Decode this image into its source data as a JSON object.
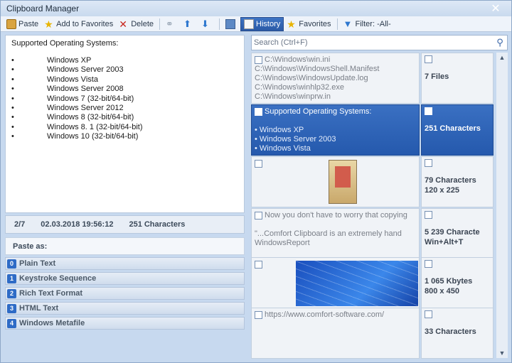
{
  "window": {
    "title": "Clipboard Manager",
    "close_glyph": "✕"
  },
  "toolbar": {
    "paste_label": "Paste",
    "add_favorites_label": "Add to Favorites",
    "delete_label": "Delete",
    "history_label": "History",
    "favorites_label": "Favorites",
    "filter_label": "Filter: -All-"
  },
  "preview": {
    "heading": "Supported Operating Systems:",
    "bullet": "•",
    "items": [
      "Windows XP",
      "Windows Server 2003",
      "Windows Vista",
      "Windows Server 2008",
      "Windows 7 (32-bit/64-bit)",
      "Windows Server 2012",
      "Windows 8 (32-bit/64-bit)",
      "Windows 8. 1 (32-bit/64-bit)",
      "Windows 10 (32-bit/64-bit)"
    ]
  },
  "info": {
    "position": "2/7",
    "date": "02.03.2018 19:56:12",
    "size": "251 Characters"
  },
  "paste_as": {
    "label": "Paste as:",
    "formats": [
      {
        "num": "0",
        "label": "Plain Text"
      },
      {
        "num": "1",
        "label": "Keystroke Sequence"
      },
      {
        "num": "2",
        "label": "Rich Text Format"
      },
      {
        "num": "3",
        "label": "HTML Text"
      },
      {
        "num": "4",
        "label": "Windows Metafile"
      }
    ]
  },
  "search": {
    "placeholder": "Search (Ctrl+F)"
  },
  "history": {
    "items": [
      {
        "lines": [
          "C:\\Windows\\win.ini",
          "C:\\Windows\\WindowsShell.Manifest",
          "C:\\Windows\\WindowsUpdate.log",
          "C:\\Windows\\winhlp32.exe",
          "C:\\Windows\\winprw.in"
        ],
        "meta": [
          "7 Files"
        ]
      },
      {
        "lines": [
          "Supported Operating Systems:",
          "",
          "• Windows XP",
          "• Windows Server 2003",
          "• Windows Vista"
        ],
        "meta": [
          "251 Characters"
        ]
      },
      {
        "lines": [],
        "meta": [
          "79 Characters",
          "120 x 225"
        ]
      },
      {
        "lines": [
          "Now you don't have to worry that copying",
          "",
          "\"...Comfort Clipboard is an extremely hand",
          "WindowsReport"
        ],
        "meta": [
          "5 239 Characte",
          "Win+Alt+T"
        ]
      },
      {
        "lines": [],
        "meta": [
          "1 065 Kbytes",
          "800 x 450"
        ]
      },
      {
        "lines": [
          "https://www.comfort-software.com/"
        ],
        "meta": [
          "33 Characters"
        ]
      }
    ]
  },
  "scroll": {
    "up": "▲",
    "down": "▼"
  }
}
